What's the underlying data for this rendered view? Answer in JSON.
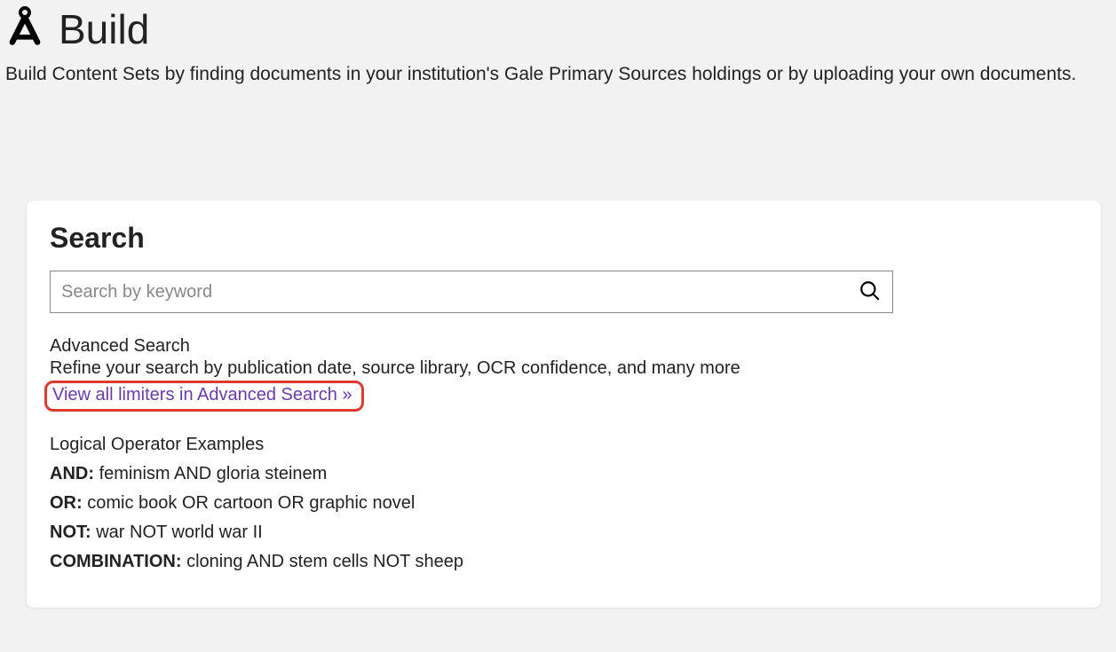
{
  "header": {
    "title": "Build",
    "subtitle": "Build Content Sets by finding documents in your institution's Gale Primary Sources holdings or by uploading your own documents."
  },
  "search": {
    "heading": "Search",
    "placeholder": "Search by keyword",
    "advanced_heading": "Advanced Search",
    "advanced_desc": "Refine your search by publication date, source library, OCR confidence, and many more",
    "advanced_link": "View all limiters in Advanced Search »",
    "operators_heading": "Logical Operator Examples",
    "operators": [
      {
        "label": "AND:",
        "example": "feminism AND gloria steinem"
      },
      {
        "label": "OR:",
        "example": "comic book OR cartoon OR graphic novel"
      },
      {
        "label": "NOT:",
        "example": "war NOT world war II"
      },
      {
        "label": "COMBINATION:",
        "example": "cloning AND stem cells NOT sheep"
      }
    ]
  }
}
